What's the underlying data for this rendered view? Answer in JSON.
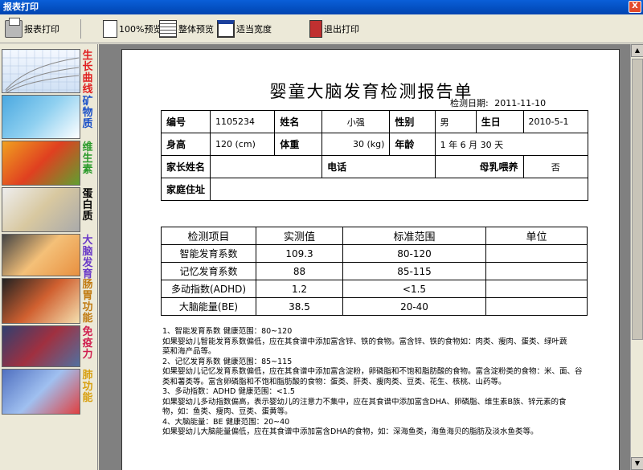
{
  "window": {
    "title": "报表打印",
    "close_label": "X"
  },
  "toolbar": {
    "print_label": "报表打印",
    "zoom100_label": "100%预览",
    "fullpage_label": "整体预览",
    "fitwidth_label": "适当宽度",
    "exit_label": "退出打印"
  },
  "sidebar": {
    "items": [
      {
        "label": [
          "生",
          "长",
          "曲",
          "线"
        ],
        "color": "#e02020",
        "icon": "growth-curve-thumbnail"
      },
      {
        "label": [
          "矿",
          "物",
          "质"
        ],
        "color": "#1a50c8",
        "icon": "minerals-thumbnail"
      },
      {
        "label": [
          "维",
          "生",
          "素"
        ],
        "color": "#2a9a2a",
        "icon": "vitamins-thumbnail"
      },
      {
        "label": [
          "蛋",
          "白",
          "质"
        ],
        "color": "#000000",
        "icon": "protein-thumbnail"
      },
      {
        "label": [
          "大",
          "脑",
          "发",
          "育"
        ],
        "color": "#6a3ac8",
        "icon": "brain-development-thumbnail"
      },
      {
        "label": [
          "肠",
          "胃",
          "功",
          "能"
        ],
        "color": "#c07a10",
        "icon": "digestion-thumbnail"
      },
      {
        "label": [
          "免",
          "疫",
          "力"
        ],
        "color": "#d02050",
        "icon": "immunity-thumbnail"
      },
      {
        "label": [
          "肺",
          "功",
          "能"
        ],
        "color": "#d8a010",
        "icon": "lung-function-thumbnail"
      }
    ]
  },
  "report": {
    "title": "婴童大脑发育检测报告单",
    "date_label": "检测日期:",
    "date_value": "2011-11-10",
    "info": {
      "id_label": "编号",
      "id_value": "1105234",
      "name_label": "姓名",
      "name_value": "小强",
      "gender_label": "性别",
      "gender_value": "男",
      "birth_label": "生日",
      "birth_value": "2010-5-1",
      "height_label": "身高",
      "height_value": "120 (cm)",
      "weight_label": "体重",
      "weight_value": "30 (kg)",
      "age_label": "年龄",
      "age_value": "1  年   6  月   30  天",
      "parent_label": "家长姓名",
      "parent_value": "",
      "phone_label": "电话",
      "phone_value": "",
      "breastfeed_label": "母乳喂养",
      "breastfeed_value": "否",
      "address_label": "家庭住址",
      "address_value": ""
    },
    "tests": {
      "headers": [
        "检测项目",
        "实测值",
        "标准范围",
        "单位"
      ],
      "rows": [
        {
          "item": "智能发育系数",
          "value": "109.3",
          "range": "80-120",
          "unit": ""
        },
        {
          "item": "记忆发育系数",
          "value": "88",
          "range": "85-115",
          "unit": ""
        },
        {
          "item": "多动指数(ADHD)",
          "value": "1.2",
          "range": "<1.5",
          "unit": ""
        },
        {
          "item": "大脑能量(BE)",
          "value": "38.5",
          "range": "20-40",
          "unit": ""
        }
      ]
    },
    "notes": [
      "1、智能发育系数      健康范围：80~120",
      "如果婴幼儿智能发育系数偏低，应在其食谱中添加富含锌、铁的食物。富含锌、铁的食物如：肉类、瘦肉、蛋类、绿叶蔬",
      "菜和海产品等。",
      "2、记忆发育系数      健康范围：85~115",
      "如果婴幼儿记忆发育系数偏低，应在其食谱中添加富含淀粉，卵磷脂和不饱和脂肪酸的食物。富含淀粉类的食物：米、面、谷",
      "类和薯类等。富含卵磷脂和不饱和脂肪酸的食物：蛋类、肝类、瘦肉类、豆类、花生、核桃、山药等。",
      "3、多动指数：ADHD    健康范围：<1.5",
      "如果婴幼儿多动指数偏高，表示婴幼儿的注意力不集中，应在其食谱中添加富含DHA、卵磷脂、维生素B族、锌元素的食",
      "物，如：鱼类、瘦肉、豆类、蛋黄等。",
      "4、大脑能量：BE      健康范围：20~40",
      "    如果婴幼儿大脑能量偏低，应在其食谱中添加富含DHA的食物，如：深海鱼类，海鱼海贝的脂肪及淡水鱼类等。"
    ]
  }
}
